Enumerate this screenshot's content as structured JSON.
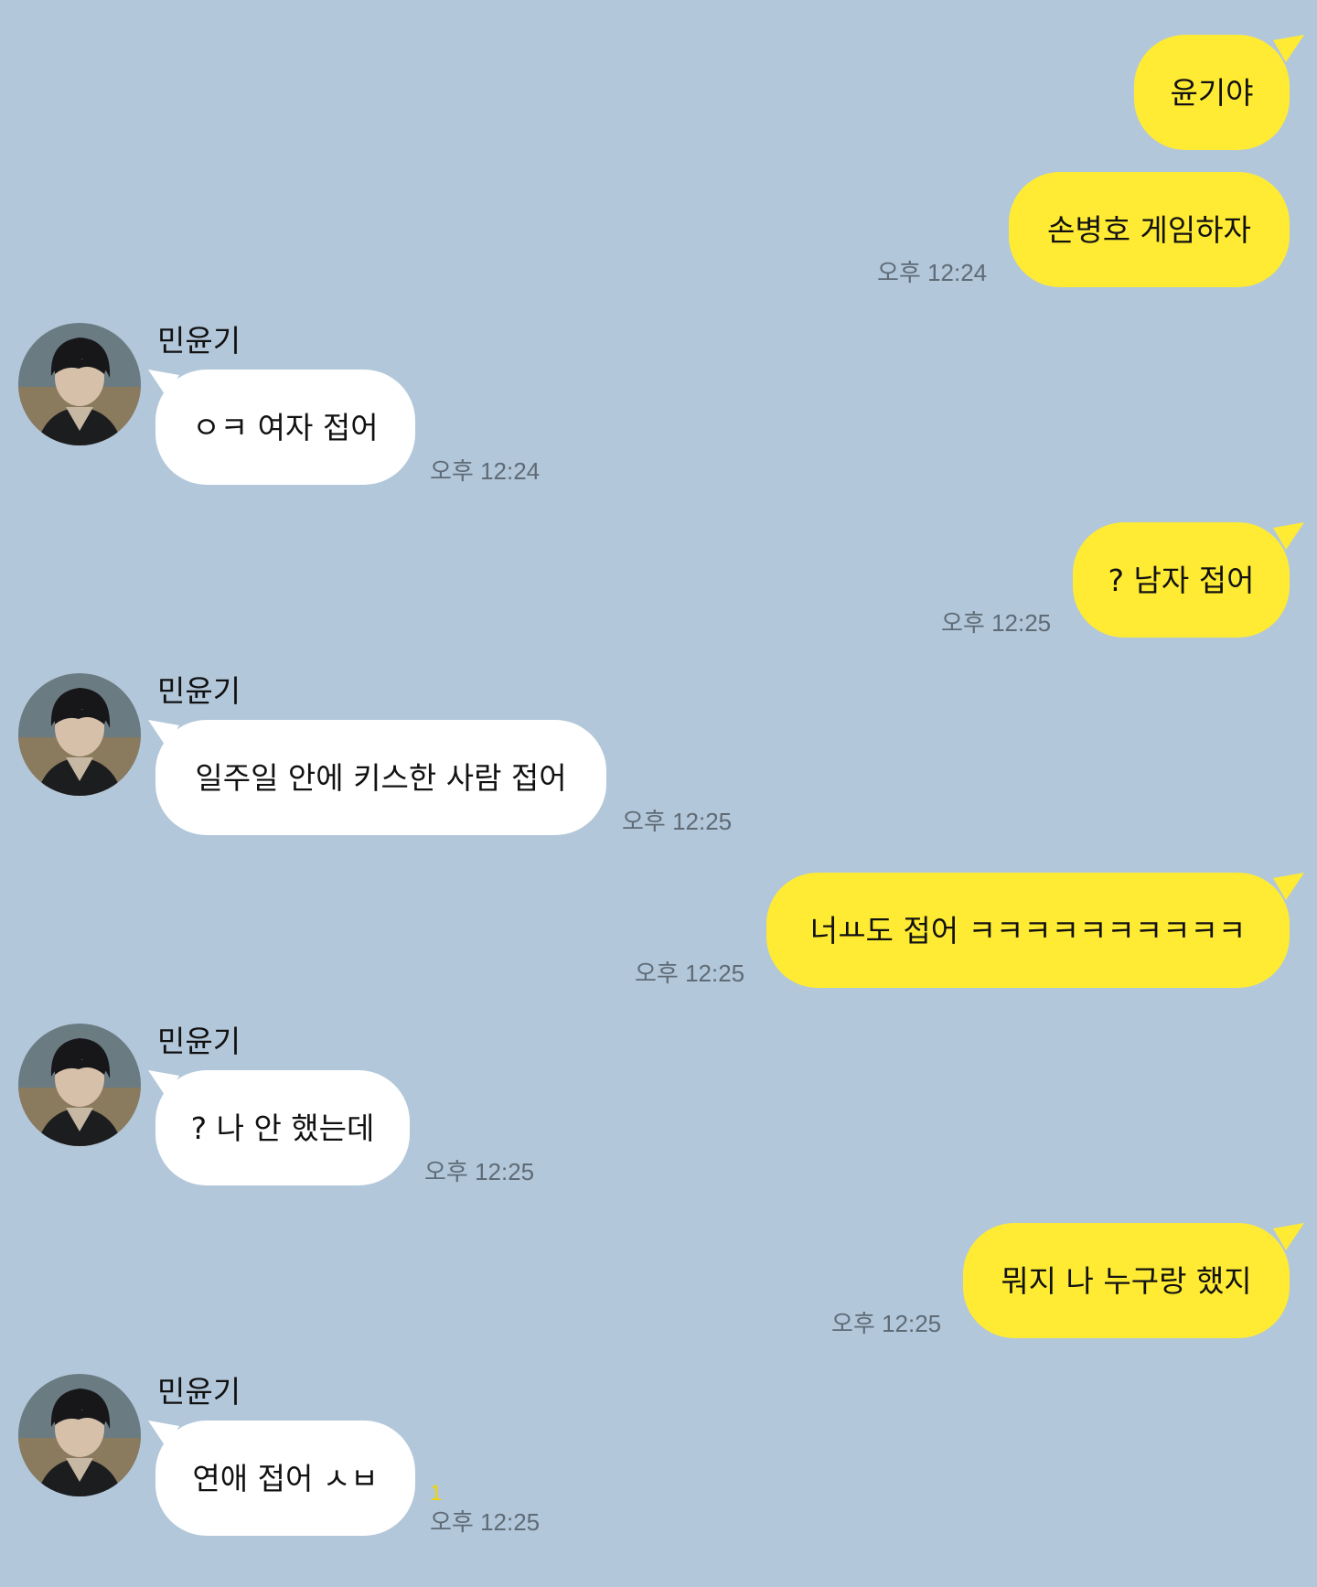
{
  "chat": {
    "partner_name": "민윤기",
    "messages": [
      {
        "from": "me",
        "text": "윤기야"
      },
      {
        "from": "me",
        "text": "손병호 게임하자",
        "time": "오후 12:24"
      },
      {
        "from": "them",
        "text": "ㅇㅋ 여자 접어",
        "time": "오후 12:24"
      },
      {
        "from": "me",
        "text": "? 남자 접어",
        "time": "오후 12:25"
      },
      {
        "from": "them",
        "text": "일주일 안에 키스한 사람 접어",
        "time": "오후 12:25"
      },
      {
        "from": "me",
        "text": "너ㅛ도 접어 ㅋㅋㅋㅋㅋㅋㅋㅋㅋㅋ",
        "time": "오후 12:25"
      },
      {
        "from": "them",
        "text": "? 나 안 했는데",
        "time": "오후 12:25"
      },
      {
        "from": "me",
        "text": "뭐지 나 누구랑 했지",
        "time": "오후 12:25"
      },
      {
        "from": "them",
        "text": "연애 접어 ㅅㅂ",
        "time": "오후 12:25",
        "unread": "1"
      }
    ]
  },
  "colors": {
    "background": "#b2c7da",
    "my_bubble": "#ffeb33",
    "their_bubble": "#ffffff",
    "timestamp": "#5f6b76",
    "unread_count": "#f2d400"
  },
  "icons": {
    "avatar": "profile-photo-avatar"
  }
}
